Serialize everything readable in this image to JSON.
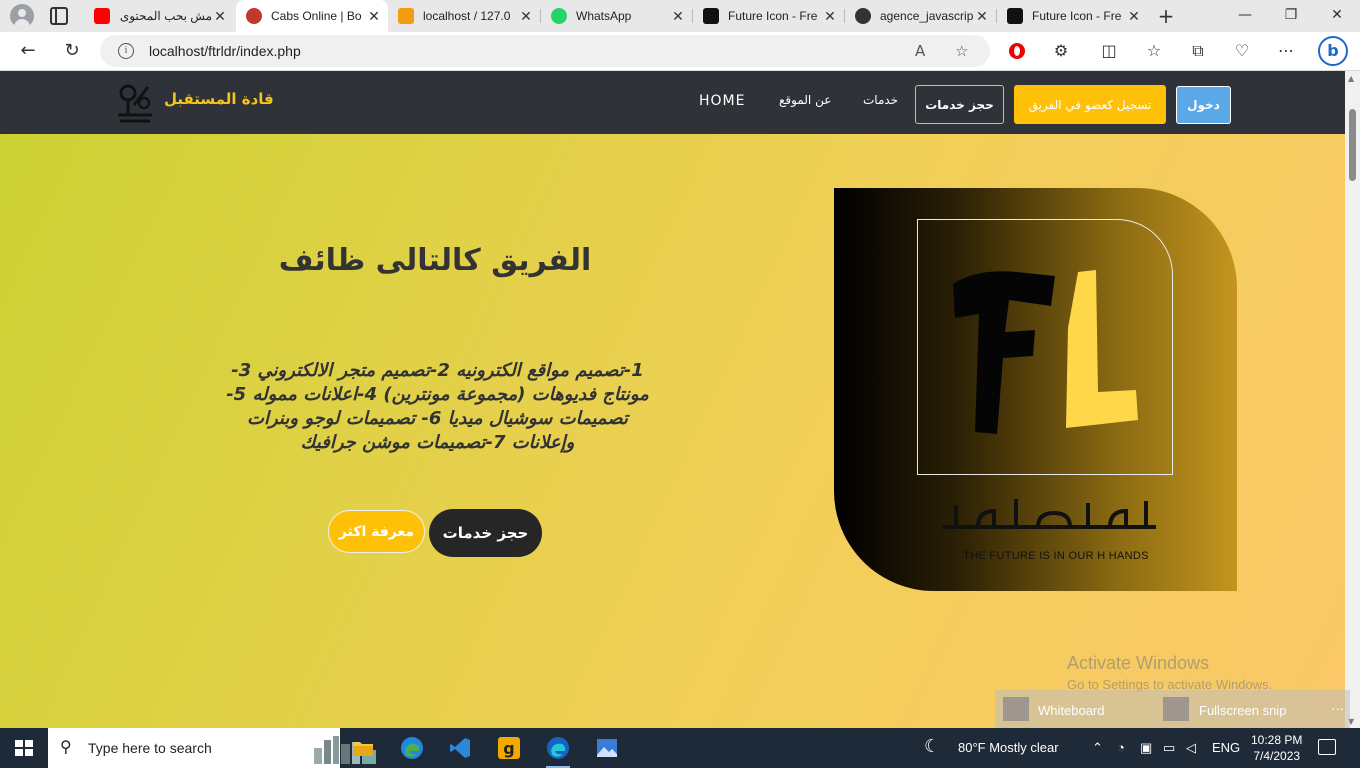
{
  "browser": {
    "tabs": [
      {
        "title": "مش بحب المحتوى",
        "fav_color": "#ff0000"
      },
      {
        "title": "Cabs Online | Bo",
        "fav_color": "#c0392b"
      },
      {
        "title": "localhost / 127.0",
        "fav_color": "#f39c12"
      },
      {
        "title": "WhatsApp",
        "fav_color": "#25d366"
      },
      {
        "title": "Future Icon - Fre",
        "fav_color": "#111111"
      },
      {
        "title": "agence_javascrip",
        "fav_color": "#333333"
      },
      {
        "title": "Future Icon - Fre",
        "fav_color": "#111111"
      }
    ],
    "url": "localhost/ftrldr/index.php",
    "new_tab": "+"
  },
  "site": {
    "brand": "قادة المستقبل",
    "nav": {
      "home": "HOME",
      "about": "عن الموقع",
      "services": "خدمات",
      "book": "حجز خدمات",
      "join": "تسجيل كعضو في الفريق",
      "login": "دخول"
    },
    "hero": {
      "title": "الفريق كالتالى ظائف",
      "description": "1-تصميم مواقع الكترونيه 2-تصميم متجر الالكتروني 3- مونتاج فديوهات (مجموعة مونترين) 4-اعلانات مموله 5-تصميمات سوشيال ميديا 6- تصميمات لوجو وبنرات وإعلانات 7-تصميمات موشن جرافيك",
      "book_button": "حجز خدمات",
      "more_button": "معرفة اكثر"
    },
    "card": {
      "tagline": "THE FUTURE IS IN OUR H HANDS"
    }
  },
  "os": {
    "activate_title": "Activate Windows",
    "activate_sub": "Go to Settings to activate Windows.",
    "snip": {
      "whiteboard": "Whiteboard",
      "fullscreen": "Fullscreen snip",
      "more": "···"
    },
    "search_placeholder": "Type here to search",
    "weather": "80°F  Mostly clear",
    "lang": "ENG",
    "time": "10:28 PM",
    "date": "7/4/2023"
  },
  "colors": {
    "accent_yellow": "#ffc107",
    "nav_dark": "#2f3238",
    "login_blue": "#5ba8e8"
  }
}
